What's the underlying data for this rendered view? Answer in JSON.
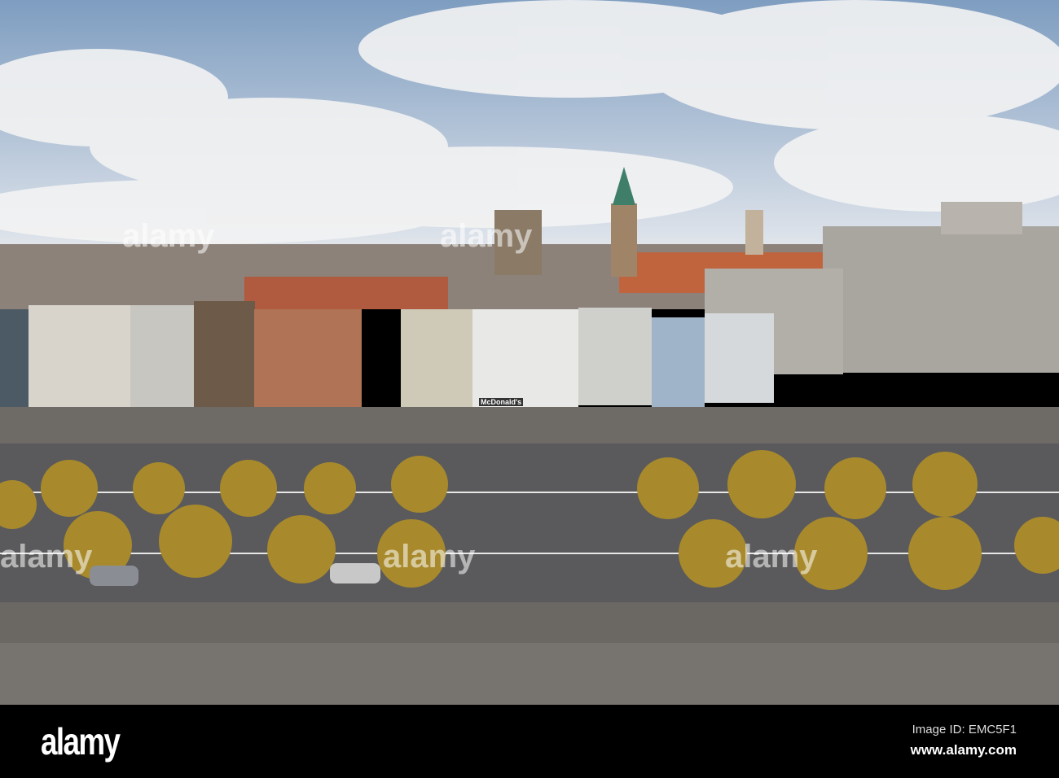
{
  "footer": {
    "logo": "alamy",
    "image_id": "Image ID: EMC5F1",
    "website": "www.alamy.com"
  },
  "watermarks": [
    "alamy",
    "alamy",
    "alamy",
    "alamy",
    "alamy"
  ],
  "signage": {
    "mcdonalds": "McDonald's"
  },
  "colors": {
    "sky_top": "#7e9dc0",
    "sky_bottom": "#e6e9ee",
    "road": "#5a5a5c",
    "pavement": "#6b6864",
    "tree": "#a88a2c"
  }
}
